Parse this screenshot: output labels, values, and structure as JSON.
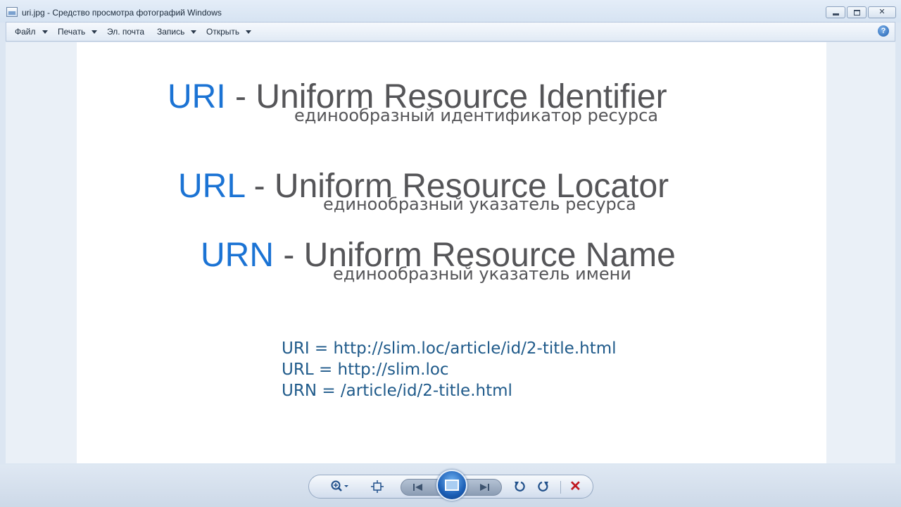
{
  "window": {
    "title": "uri.jpg - Средство просмотра фотографий Windows"
  },
  "menu": [
    {
      "label": "Файл",
      "has_dropdown": true
    },
    {
      "label": "Печать",
      "has_dropdown": true
    },
    {
      "label": "Эл. почта",
      "has_dropdown": false
    },
    {
      "label": "Запись",
      "has_dropdown": true
    },
    {
      "label": "Открыть",
      "has_dropdown": true
    }
  ],
  "help_icon": "help-icon",
  "photo": {
    "sections": [
      {
        "abbr": "URI",
        "rest": " - Uniform Resource Identifier",
        "subtitle": "единообразный идентификатор ресурса"
      },
      {
        "abbr": "URL",
        "rest": " - Uniform Resource Locator",
        "subtitle": "единообразный указатель ресурса"
      },
      {
        "abbr": "URN",
        "rest": " - Uniform Resource Name",
        "subtitle": "единообразный указатель имени"
      }
    ],
    "examples": [
      "URI = http://slim.loc/article/id/2-title.html",
      "URL = http://slim.loc",
      "URN = /article/id/2-title.html"
    ]
  },
  "colors": {
    "accent_blue": "#1b73d4",
    "heading_gray": "#555558",
    "example_blue": "#1f5a8a",
    "delete_red": "#c0181f"
  },
  "controls": {
    "zoom": "zoom-icon",
    "fit": "actual-size-icon",
    "prev": "previous-icon",
    "slideshow": "slideshow-icon",
    "next": "next-icon",
    "rotate_ccw": "rotate-counterclockwise-icon",
    "rotate_cw": "rotate-clockwise-icon",
    "delete": "delete-icon"
  }
}
